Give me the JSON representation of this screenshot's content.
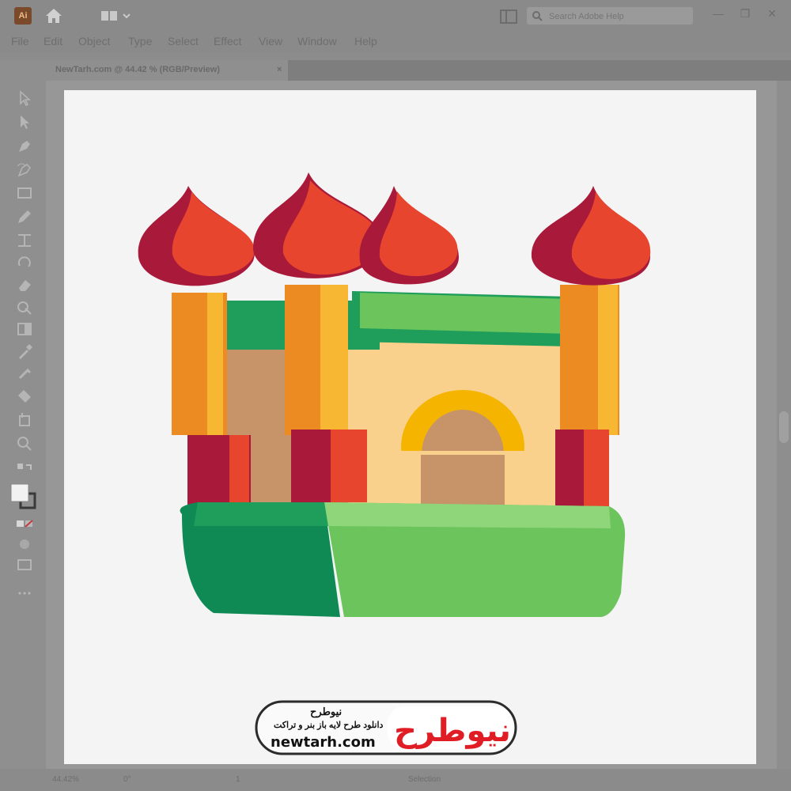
{
  "app": {
    "logo": "Ai"
  },
  "search": {
    "placeholder": "Search Adobe Help"
  },
  "menu": [
    "File",
    "Edit",
    "Object",
    "Type",
    "Select",
    "Effect",
    "View",
    "Window",
    "Help"
  ],
  "document_tab": {
    "title": "NewTarh.com @ 44.42 % (RGB/Preview)",
    "close": "×"
  },
  "window_controls": {
    "minimize": "—",
    "restore": "❐",
    "close": "✕"
  },
  "status": {
    "zoom": "44.42%",
    "rotation": "0°",
    "artboard": "1",
    "mode": "Selection"
  },
  "icons": {
    "home": "home-icon",
    "workspace": "workspace-switcher-icon",
    "panel": "arrange-documents-icon",
    "search": "search-icon",
    "tools": [
      "selection-tool-icon",
      "direct-selection-tool-icon",
      "pen-tool-icon",
      "curvature-tool-icon",
      "rectangle-tool-icon",
      "pencil-tool-icon",
      "width-tool-icon",
      "rotate-tool-icon",
      "eraser-tool-icon",
      "shape-builder-icon",
      "gradient-tool-icon",
      "eyedropper-tool-icon",
      "symbol-sprayer-icon",
      "artboard-tool-icon",
      "hand-tool-icon",
      "zoom-tool-icon"
    ]
  },
  "watermark": {
    "name": "نیوطرح",
    "tagline": "دانلود طرح لایه باز بنر و تراکت",
    "url": "newtarh.com",
    "logo_text": "نیوطرح"
  },
  "colors": {
    "dome_red": "#e8452f",
    "dome_dark": "#a8193a",
    "pillar_orange": "#ec8b22",
    "pillar_yellow": "#f7b733",
    "wall": "#f9d08c",
    "wall_shade": "#c7946a",
    "green": "#1e9d5b",
    "green_light": "#6bc55c",
    "arch": "#f4b400"
  }
}
